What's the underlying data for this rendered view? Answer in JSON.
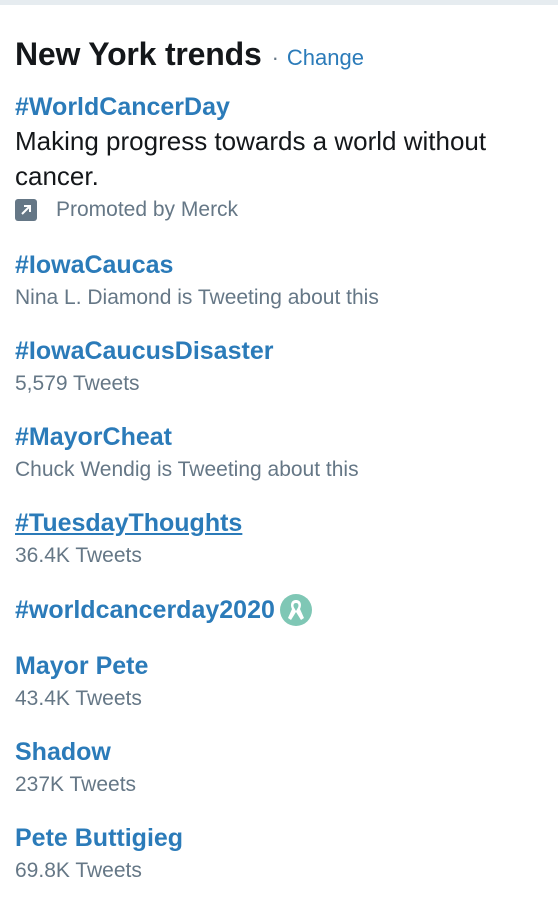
{
  "header": {
    "title": "New York trends",
    "separator": "·",
    "change_label": "Change"
  },
  "promoted": {
    "name": "#WorldCancerDay",
    "description": "Making progress towards a world without cancer.",
    "promoted_by": "Promoted by Merck",
    "icon": "promoted-arrow-icon"
  },
  "trends": [
    {
      "name": "#IowaCaucas",
      "meta": "Nina L. Diamond is Tweeting about this"
    },
    {
      "name": "#IowaCaucusDisaster",
      "meta": "5,579 Tweets"
    },
    {
      "name": "#MayorCheat",
      "meta": "Chuck Wendig is Tweeting about this"
    },
    {
      "name": "#TuesdayThoughts",
      "meta": "36.4K Tweets"
    },
    {
      "name": "#worldcancerday2020",
      "meta": "",
      "icon": "awareness-ribbon-icon"
    },
    {
      "name": "Mayor Pete",
      "meta": "43.4K Tweets"
    },
    {
      "name": "Shadow",
      "meta": "237K Tweets"
    },
    {
      "name": "Pete Buttigieg",
      "meta": "69.8K Tweets"
    }
  ],
  "colors": {
    "link": "#2b7bb9",
    "muted": "#657786",
    "text": "#14171a",
    "ribbon": "#7fc7b5"
  }
}
